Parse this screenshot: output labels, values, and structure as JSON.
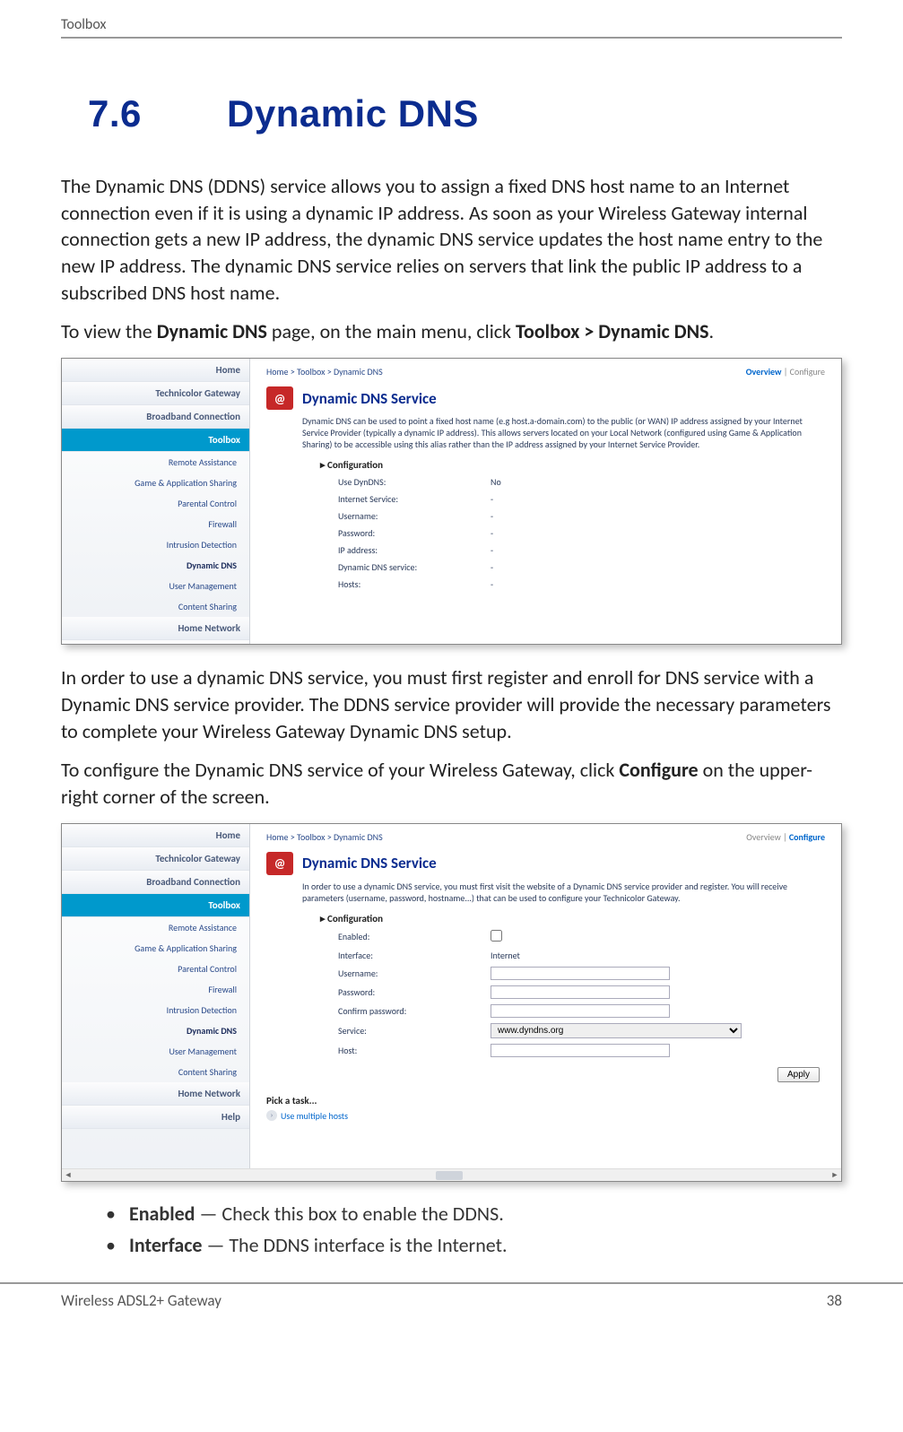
{
  "header": {
    "section": "Toolbox"
  },
  "heading": {
    "num": "7.6",
    "title": "Dynamic DNS"
  },
  "para1": "The Dynamic DNS (DDNS) service allows you to assign a fixed DNS host name to an Internet connection even if it is using a dynamic IP address. As soon as your Wireless Gateway internal connection gets a new IP address, the dynamic DNS service updates the host name entry to the new IP address. The dynamic DNS service relies on servers that link the public IP address to a subscribed DNS host name.",
  "para2_pre": "To view the ",
  "para2_b1": "Dynamic DNS",
  "para2_mid": " page, on the main menu, click ",
  "para2_b2": "Toolbox > Dynamic DNS",
  "para2_end": ".",
  "para3": "In order to use a dynamic DNS service, you must first register and enroll for DNS service with a Dynamic DNS service provider. The DDNS service provider will provide the necessary parameters to complete your Wireless Gateway Dynamic DNS setup.",
  "para4_pre": "To configure the Dynamic DNS service of your Wireless Gateway, click ",
  "para4_b": "Configure",
  "para4_end": " on the upper-right corner of the screen.",
  "sidebar": {
    "top": [
      "Home",
      "Technicolor Gateway",
      "Broadband Connection"
    ],
    "active": "Toolbox",
    "subs": [
      "Remote Assistance",
      "Game & Application Sharing",
      "Parental Control",
      "Firewall",
      "Intrusion Detection",
      "Dynamic DNS",
      "User Management",
      "Content Sharing"
    ],
    "bottom": [
      "Home Network",
      "Help"
    ]
  },
  "shot": {
    "crumbs": "Home > Toolbox > Dynamic DNS",
    "overview": "Overview",
    "configure": "Configure",
    "sep": " | ",
    "title": "Dynamic DNS Service",
    "icon_label": "@",
    "cfg_header": "Configuration"
  },
  "shot1": {
    "desc": "Dynamic DNS can be used to point a fixed host name (e.g host.a-domain.com) to the public (or WAN) IP address assigned by your Internet Service Provider (typically a dynamic IP address). This allows servers located on your Local Network (configured using Game & Application Sharing) to be accessible using this alias rather than the IP address assigned by your Internet Service Provider.",
    "rows": {
      "use": "Use DynDNS:",
      "use_v": "No",
      "isvc": "Internet Service:",
      "isvc_v": "-",
      "user": "Username:",
      "user_v": "-",
      "pass": "Password:",
      "pass_v": "-",
      "ip": "IP address:",
      "ip_v": "-",
      "dsvc": "Dynamic DNS service:",
      "dsvc_v": "-",
      "hosts": "Hosts:",
      "hosts_v": "-"
    }
  },
  "shot2": {
    "desc": "In order to use a dynamic DNS service, you must first visit the website of a Dynamic DNS service provider and register. You will receive parameters (username, password, hostname...) that can be used to configure your Technicolor Gateway.",
    "rows": {
      "enabled": "Enabled:",
      "iface": "Interface:",
      "iface_v": "Internet",
      "user": "Username:",
      "pass": "Password:",
      "cpass": "Confirm password:",
      "svc": "Service:",
      "svc_v": "www.dyndns.org",
      "host": "Host:"
    },
    "apply": "Apply",
    "pick": "Pick a task...",
    "task": "Use multiple hosts"
  },
  "bullets": {
    "b1_h": "Enabled",
    "b1_t": " — Check this box to enable the DDNS.",
    "b2_h": "Interface",
    "b2_t": " — The DDNS interface is the Internet."
  },
  "footer": {
    "left": "Wireless ADSL2+ Gateway",
    "right": "38"
  }
}
